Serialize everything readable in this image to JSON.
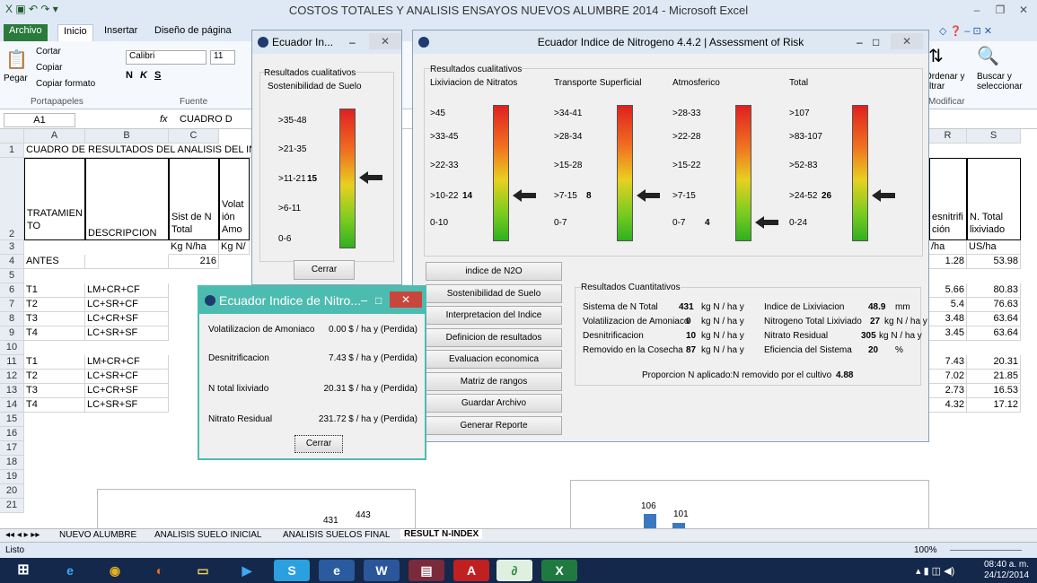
{
  "excel": {
    "title": "COSTOS TOTALES Y ANALISIS  ENSAYOS NUEVOS ALUMBRE 2014 - Microsoft Excel",
    "tabs": [
      "Archivo",
      "Inicio",
      "Insertar",
      "Diseño de página"
    ],
    "clipboard": {
      "cut": "Cortar",
      "copy": "Copiar",
      "paste": "Pegar",
      "format": "Copiar formato",
      "group": "Portapapeles"
    },
    "font": {
      "name": "Calibri",
      "size": "11",
      "bold": "N",
      "italic": "K",
      "underline": "S",
      "group": "Fuente"
    },
    "editing": {
      "sort": "Ordenar y filtrar",
      "find": "Buscar y seleccionar",
      "group": "Modificar"
    },
    "name_box": "A1",
    "formula": "CUADRO D",
    "col_headers": [
      "A",
      "B",
      "C",
      "R",
      "S"
    ],
    "rows": {
      "r1": "CUADRO DE RESULTADOS DEL ANALISIS DEL IND",
      "h_tratamiento": "TRATAMIEN TO",
      "h_desc": "DESCRIPCION",
      "h_sist": "Sist de N Total",
      "h_volat": "Volat ión Amo",
      "h_desnit": "esnitrifi ción",
      "h_ntotal": "N. Total lixiviado",
      "u_c": "Kg N/ha",
      "u_d": "Kg N/",
      "u_r": "/ha",
      "u_s": "US/ha",
      "antes": "ANTES",
      "antes_c": "216",
      "antes_r": "1.28",
      "antes_s": "53.98"
    },
    "row_numbers": [
      "1",
      "2",
      "3",
      "4",
      "5",
      "6",
      "7",
      "8",
      "9",
      "10",
      "11",
      "12",
      "13",
      "14",
      "15",
      "16",
      "17",
      "18",
      "19",
      "20",
      "21"
    ],
    "treat_rows": [
      {
        "a": "T1",
        "b": "LM+CR+CF",
        "r": "5.66",
        "s": "80.83"
      },
      {
        "a": "T2",
        "b": "LC+SR+CF",
        "r": "5.4",
        "s": "76.63"
      },
      {
        "a": "T3",
        "b": "LC+CR+SF",
        "r": "3.48",
        "s": "63.64"
      },
      {
        "a": "T4",
        "b": "LC+SR+SF",
        "r": "3.45",
        "s": "63.64"
      },
      {
        "a": "T1",
        "b": "LM+CR+CF",
        "r": "7.43",
        "s": "20.31"
      },
      {
        "a": "T2",
        "b": "LC+SR+CF",
        "r": "7.02",
        "s": "21.85"
      },
      {
        "a": "T3",
        "b": "LC+CR+SF",
        "r": "2.73",
        "s": "16.53"
      },
      {
        "a": "T4",
        "b": "LC+SR+SF",
        "r": "4.32",
        "s": "17.12"
      }
    ],
    "chart_labels": [
      "431",
      "443",
      "106",
      "101"
    ],
    "sheet_tabs": [
      "NUEVO ALUMBRE",
      "ANALISIS SUELO INICIAL",
      "ANALISIS SUELOS FINAL",
      "RESULT N-INDEX"
    ],
    "status": "Listo",
    "zoom": "100%"
  },
  "dlg_small": {
    "title": "Ecuador In...",
    "group": "Resultados cualitativos",
    "subgroup": "Sostenibilidad de Suelo",
    "ranges": [
      ">35-48",
      ">21-35",
      ">11-21",
      ">6-11",
      "0-6"
    ],
    "value": "15",
    "close": "Cerrar"
  },
  "dlg_main": {
    "title": "Ecuador Indice de Nitrogeno 4.4.2 | Assessment of Risk",
    "group": "Resultados cualitativos",
    "gauges": [
      {
        "name": "Lixiviacion de Nitratos",
        "ranges": [
          ">45",
          ">33-45",
          ">22-33",
          ">10-22",
          "0-10"
        ],
        "value": "14"
      },
      {
        "name": "Transporte Superficial",
        "ranges": [
          ">34-41",
          ">28-34",
          ">15-28",
          ">7-15",
          "0-7"
        ],
        "value": "8"
      },
      {
        "name": "Atmosferico",
        "ranges": [
          ">28-33",
          ">22-28",
          ">15-22",
          ">7-15",
          "0-7"
        ],
        "value": "4"
      },
      {
        "name": "Total",
        "ranges": [
          ">107",
          ">83-107",
          ">52-83",
          ">24-52",
          "0-24"
        ],
        "value": "26"
      }
    ],
    "buttons": [
      "indice de N2O",
      "Sostenibilidad de Suelo",
      "Interpretacion del Indice",
      "Definicion de resultados",
      "Evaluacion economica",
      "Matriz de rangos",
      "Guardar Archivo",
      "Generar Reporte"
    ],
    "quant_title": "Resultados Cuantitativos",
    "quant": [
      {
        "l": "Sistema de N Total",
        "v": "431",
        "u": "kg N / ha y",
        "l2": "Indice de Lixiviacion",
        "v2": "48.9",
        "u2": "mm"
      },
      {
        "l": "Volatilizacion de Amoniaco",
        "v": "0",
        "u": "kg N / ha y",
        "l2": "Nitrogeno Total Lixiviado",
        "v2": "27",
        "u2": "kg N / ha y"
      },
      {
        "l": "Desnitrificacion",
        "v": "10",
        "u": "kg N / ha y",
        "l2": "Nitrato Residual",
        "v2": "305",
        "u2": "kg N / ha y"
      },
      {
        "l": "Removido en la Cosecha",
        "v": "87",
        "u": "kg N / ha y",
        "l2": "Eficiencia del Sistema",
        "v2": "20",
        "u2": "%"
      }
    ],
    "ratio_label": "Proporcion N aplicado:N removido por el cultivo",
    "ratio_value": "4.88"
  },
  "dlg_cost": {
    "title": "Ecuador Indice de Nitro...",
    "rows": [
      {
        "l": "Volatilizacion de Amoniaco",
        "v": "0.00  $ / ha y (Perdida)"
      },
      {
        "l": "Desnitrificacion",
        "v": "7.43  $ / ha y (Perdida)"
      },
      {
        "l": "N total lixiviado",
        "v": "20.31  $ / ha y (Perdida)"
      },
      {
        "l": "Nitrato Residual",
        "v": "231.72  $ / ha y (Perdida)"
      }
    ],
    "close": "Cerrar"
  },
  "taskbar": {
    "time": "08:40 a. m.",
    "date": "24/12/2014"
  }
}
